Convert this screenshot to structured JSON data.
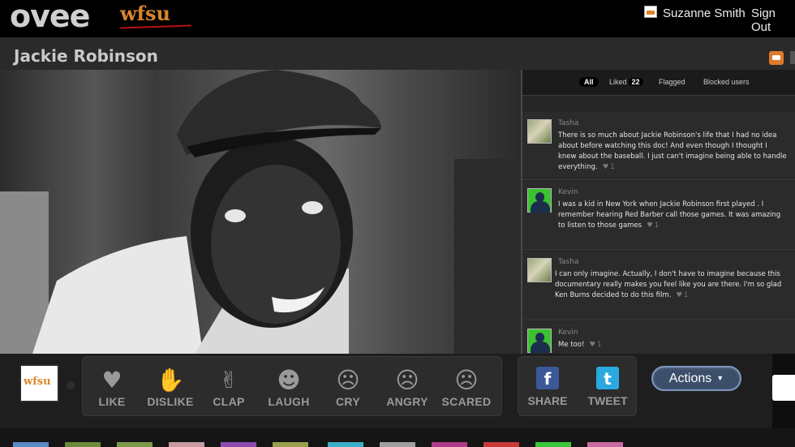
{
  "header": {
    "logo": "ovee",
    "station": "wfsu",
    "user_name": "Suzanne Smith",
    "signout": "Sign Out"
  },
  "page": {
    "title": "Jackie Robinson"
  },
  "comments": {
    "filters": {
      "all": "All",
      "liked": "Liked",
      "liked_count": "22",
      "flagged": "Flagged",
      "blocked": "Blocked users"
    },
    "items": [
      {
        "author": "Tasha",
        "text": "There is so much about Jackie Robinson's life that I had no idea about before watching this doc!  And even though I thought I knew  about the baseball. I just can't imagine being able to handle everything.",
        "likes": "1"
      },
      {
        "author": "Kevin",
        "text": "I was a kid in New York when Jackie Robinson first played . I remember hearing Red Barber call those games.  It was amazing to listen to those games",
        "likes": "1"
      },
      {
        "author": "Tasha",
        "text": "I can only imagine. Actually, I don't have to imagine because this documentary really makes you feel like you are there. I'm so glad Ken Burns decided to do this film.",
        "likes": "1"
      },
      {
        "author": "Kevin",
        "text": "Me too!",
        "likes": "1"
      }
    ]
  },
  "controls": {
    "channel_logo": "wfsu",
    "reactions": [
      {
        "label": "LIKE",
        "icon": "heart-icon"
      },
      {
        "label": "DISLIKE",
        "icon": "thumbs-down-icon"
      },
      {
        "label": "CLAP",
        "icon": "clap-icon"
      },
      {
        "label": "LAUGH",
        "icon": "laugh-icon"
      },
      {
        "label": "CRY",
        "icon": "cry-icon"
      },
      {
        "label": "ANGRY",
        "icon": "angry-icon"
      },
      {
        "label": "SCARED",
        "icon": "scared-icon"
      }
    ],
    "share": [
      {
        "label": "SHARE",
        "icon": "facebook-icon",
        "glyph": "f",
        "color": "#3b5998"
      },
      {
        "label": "TWEET",
        "icon": "twitter-icon",
        "glyph": "t",
        "color": "#2aa9e0"
      }
    ],
    "actions_label": "Actions",
    "colors": {
      "accent": "#e07a2a",
      "actions_button": "#3b4e6a"
    }
  }
}
